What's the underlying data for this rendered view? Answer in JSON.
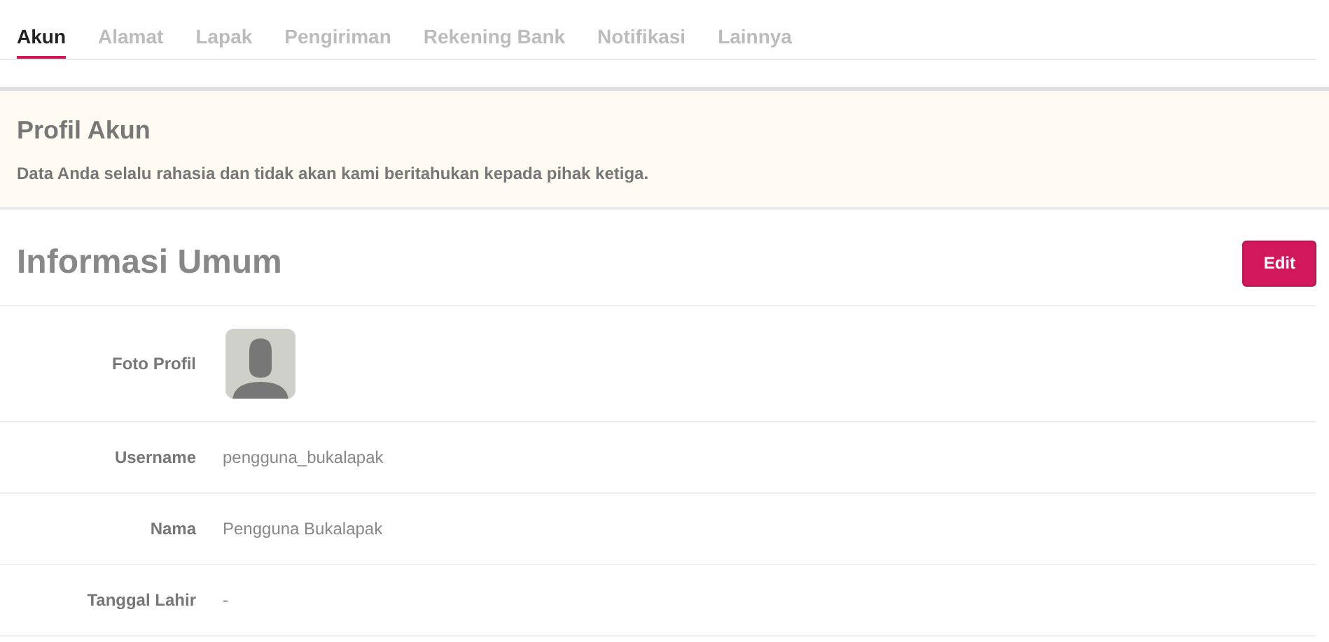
{
  "tabs": [
    {
      "label": "Akun",
      "selected": true
    },
    {
      "label": "Alamat",
      "selected": false
    },
    {
      "label": "Lapak",
      "selected": false
    },
    {
      "label": "Pengiriman",
      "selected": false
    },
    {
      "label": "Rekening Bank",
      "selected": false
    },
    {
      "label": "Notifikasi",
      "selected": false
    },
    {
      "label": "Lainnya",
      "selected": false
    }
  ],
  "notice": {
    "title": "Profil Akun",
    "text": "Data Anda selalu rahasia dan tidak akan kami beritahukan kepada pihak ketiga."
  },
  "section": {
    "title": "Informasi Umum",
    "button": "Edit"
  },
  "fields": [
    {
      "kind": "photo",
      "label": "Foto Profil"
    },
    {
      "kind": "text",
      "label": "Username",
      "value": "pengguna_bukalapak"
    },
    {
      "kind": "text",
      "label": "Nama",
      "value": "Pengguna Bukalapak"
    },
    {
      "kind": "text",
      "label": "Tanggal Lahir",
      "value": "-"
    }
  ]
}
